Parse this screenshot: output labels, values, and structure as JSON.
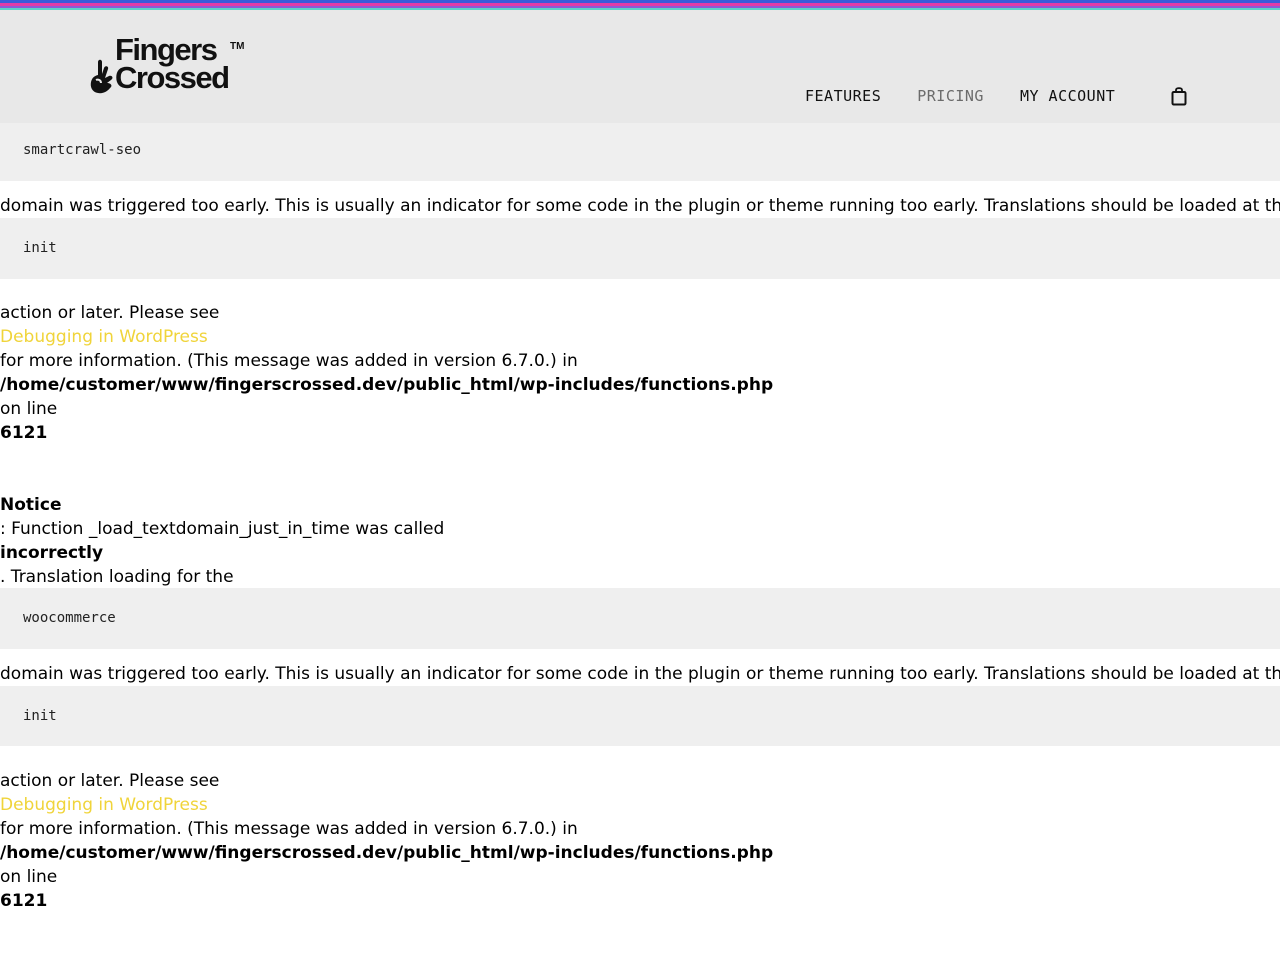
{
  "brand": {
    "logo_line1": "Fingers",
    "logo_line2": "Crossed",
    "logo_tm": "TM",
    "stripe_colors": [
      "#3a5bd9",
      "#e23aa8",
      "#8a5bd6",
      "#5fd0c8"
    ]
  },
  "nav": {
    "features": "FEATURES",
    "pricing": "PRICING",
    "account": "MY ACCOUNT",
    "cart_icon": "shopping-bag-icon"
  },
  "notices": [
    {
      "domain_code": "smartcrawl-seo",
      "triggered_text": "domain was triggered too early. This is usually an indicator for some code in the plugin or theme running too early. Translations should be loaded at the",
      "init_code": "init",
      "action_text": "action or later. Please see",
      "link_text": "Debugging in WordPress",
      "info_text": "for more information. (This message was added in version 6.7.0.) in",
      "path": "/home/customer/www/fingerscrossed.dev/public_html/wp-includes/functions.php",
      "on_line": "on line",
      "line_number": "6121"
    },
    {
      "notice_label": "Notice",
      "function_text": ": Function _load_textdomain_just_in_time was called",
      "incorrectly": "incorrectly",
      "translation_text": ". Translation loading for the",
      "domain_code": "woocommerce",
      "triggered_text": "domain was triggered too early. This is usually an indicator for some code in the plugin or theme running too early. Translations should be loaded at the",
      "init_code": "init",
      "action_text": "action or later. Please see",
      "link_text": "Debugging in WordPress",
      "info_text": "for more information. (This message was added in version 6.7.0.) in",
      "path": "/home/customer/www/fingerscrossed.dev/public_html/wp-includes/functions.php",
      "on_line": "on line",
      "line_number": "6121"
    }
  ],
  "colors": {
    "link": "#f0d43a",
    "code_bg": "#efefef",
    "header_bg": "#e8e8e8"
  }
}
